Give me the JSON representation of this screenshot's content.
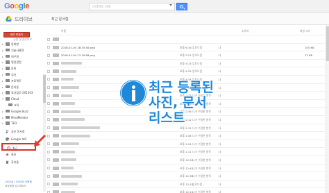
{
  "header": {
    "logo_letters": [
      "G",
      "o",
      "o",
      "g",
      "l",
      "e"
    ],
    "logo_colors": [
      "#4285f4",
      "#ea4335",
      "#fbbc05",
      "#4285f4",
      "#34a853",
      "#ea4335"
    ],
    "search_placeholder": "드라이브 검색",
    "search_icon": "search-icon"
  },
  "subheader": {
    "app_title": "드라이브",
    "page_title": "최근 문서함",
    "drive_icon": "drive-icon"
  },
  "sidebar": {
    "new_button": "새로 만들기",
    "tree_top_cut": "공방 동영상자료",
    "tree": [
      {
        "label": "동화방",
        "chev": "▸"
      },
      {
        "label": "기술사관련",
        "chev": "▸"
      },
      {
        "label": "대구원",
        "chev": "▸"
      },
      {
        "label": "명장관련",
        "chev": "▸"
      },
      {
        "label": "동회",
        "chev": "▸"
      },
      {
        "label": "심사",
        "chev": "▸"
      },
      {
        "label": "프로젝트",
        "chev": "▸"
      },
      {
        "label": "문지용",
        "chev": "▸"
      },
      {
        "label": "휴지없무-201303",
        "chev": "▸"
      },
      {
        "label": "Cloud",
        "chev": "▾"
      },
      {
        "label": "교육",
        "chev": ""
      },
      {
        "label": "Google Buzz",
        "chev": "▸"
      },
      {
        "label": "MindMeister",
        "chev": "▸"
      },
      {
        "label": "TED",
        "chev": "▸"
      }
    ],
    "nav": [
      {
        "label": "공유 문서함",
        "icon": "shared-people-icon"
      },
      {
        "label": "Google 포토",
        "icon": "photos-pinwheel-icon"
      },
      {
        "label": "최근",
        "icon": "clock-icon",
        "selected": true
      },
      {
        "label": "중요",
        "icon": "star-icon"
      },
      {
        "label": "휴지통",
        "icon": "trash-icon"
      }
    ],
    "storage_usage": "140GB / 150GB 사용됨",
    "storage_upgrade": "저장용량 업그레이드"
  },
  "list": {
    "columns": {
      "name": "이름",
      "owner": "소유자",
      "size": "파일 크기"
    },
    "rows": [
      {
        "name": "",
        "owner": "",
        "owner2": "",
        "me": "",
        "size": "",
        "blur": 0
      },
      {
        "name": "2016-01-04 18:15:40.png",
        "owner": "오후 6:16",
        "owner2": "업로드함",
        "me": "나",
        "size": "105 KB",
        "blur": 0
      },
      {
        "name": "2016-01-04 17:19:56.png",
        "owner": "오후 5:21",
        "owner2": "업로드함",
        "me": "나",
        "size": "73 KB",
        "blur": 0
      },
      {
        "name": "",
        "owner": "오후 5:13",
        "owner2": "업로드함",
        "me": "나",
        "size": "",
        "blur": 30
      },
      {
        "name": "",
        "owner": "오후 4:35",
        "owner2": "업로드함",
        "me": "나",
        "size": "",
        "blur": 22
      },
      {
        "name": "",
        "owner": "오후 4:34",
        "owner2": "업로드함",
        "me": "나",
        "size": "",
        "blur": 18
      },
      {
        "name": "",
        "owner": "오후 4:31",
        "owner2": "업로드함",
        "me": "나",
        "size": "",
        "blur": 26
      },
      {
        "name": "",
        "owner": "오후 2:38",
        "owner2": "나가 수정한 항목",
        "me": "나",
        "size": "",
        "blur": 16
      },
      {
        "name": "",
        "owner": "오후 2:38",
        "owner2": "나가 수정한 항목",
        "me": "나",
        "size": "",
        "blur": 20
      },
      {
        "name": "",
        "owner": "오후 2:38",
        "owner2": "나가 수정한 항목",
        "me": "나",
        "size": "",
        "blur": 28
      },
      {
        "name": "",
        "owner": "오후 2:12",
        "owner2": "나가 수정한 항목",
        "me": "나",
        "size": "",
        "blur": 34
      },
      {
        "name": "",
        "owner": "오후 2:12",
        "owner2": "나가 수정한 항목",
        "me": "나",
        "size": "",
        "blur": 56
      },
      {
        "name": "",
        "owner": "오후 1:46",
        "owner2": "나가 수정한 항목",
        "me": "나",
        "size": "",
        "blur": 42
      },
      {
        "name": "",
        "owner": "오후 1:24",
        "owner2": "나가 수정한 항목",
        "me": "나",
        "size": "",
        "blur": 26
      },
      {
        "name": "",
        "owner": "오후 1:11",
        "owner2": "나가 수정한 항목",
        "me": "나",
        "size": "",
        "blur": 20
      },
      {
        "name": "",
        "owner": "오후 12:55",
        "owner2": "나가 수정한 항목",
        "me": "나",
        "size": "",
        "blur": 22
      },
      {
        "name": "",
        "owner": "오후 12:41",
        "owner2": "나가 수정한 항목",
        "me": "나",
        "size": "",
        "blur": 18
      },
      {
        "name": "",
        "owner": "오후 12:38",
        "owner2": "나가 수정한 항목",
        "me": "나",
        "size": "",
        "blur": 30
      },
      {
        "name": "",
        "owner": "오후 12:15",
        "owner2": "업로드함",
        "me": "나",
        "size": "",
        "blur": 24
      },
      {
        "name": "",
        "owner": "오후 12:11",
        "owner2": "나가 수정한 항목",
        "me": "나",
        "size": "",
        "blur": 20
      }
    ]
  },
  "overlay": {
    "info_icon": "info-icon",
    "info_color": "#1e88d9",
    "lines": [
      "최근 등록된",
      "사진, 문서",
      "리스트"
    ]
  }
}
